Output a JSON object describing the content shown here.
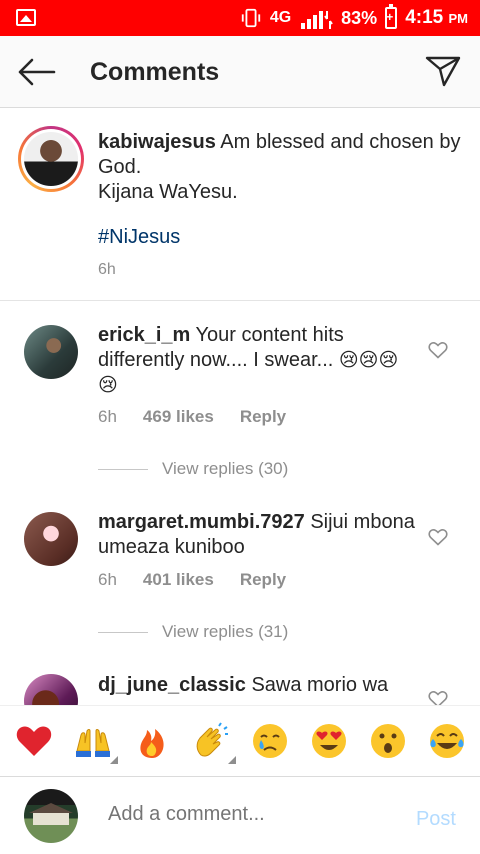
{
  "status": {
    "network": "4G",
    "battery": "83%",
    "time": "4:15",
    "ampm": "PM"
  },
  "header": {
    "title": "Comments"
  },
  "post": {
    "username": "kabiwajesus",
    "caption_line1": "Am blessed and chosen by God.",
    "caption_line2": "Kijana WaYesu.",
    "hashtag": "#NiJesus",
    "time": "6h"
  },
  "comments": [
    {
      "username": "erick_i_m",
      "text": "Your content hits differently now.... I swear...",
      "emoji": "😢😢😢😢",
      "time": "6h",
      "likes": "469 likes",
      "reply": "Reply",
      "view_replies": "View replies (30)"
    },
    {
      "username": "margaret.mumbi.7927",
      "text": "Sijui mbona umeaza kuniboo",
      "time": "6h",
      "likes": "401 likes",
      "reply": "Reply",
      "view_replies": "View replies (31)"
    },
    {
      "username": "dj_june_classic",
      "text": "Sawa morio wa"
    }
  ],
  "emoji_bar": [
    "heart-emoji",
    "raising-hands-emoji",
    "fire-emoji",
    "clapping-emoji",
    "crying-emoji",
    "heart-eyes-emoji",
    "surprised-emoji",
    "tears-of-joy-emoji"
  ],
  "composer": {
    "placeholder": "Add a comment...",
    "post_label": "Post"
  }
}
